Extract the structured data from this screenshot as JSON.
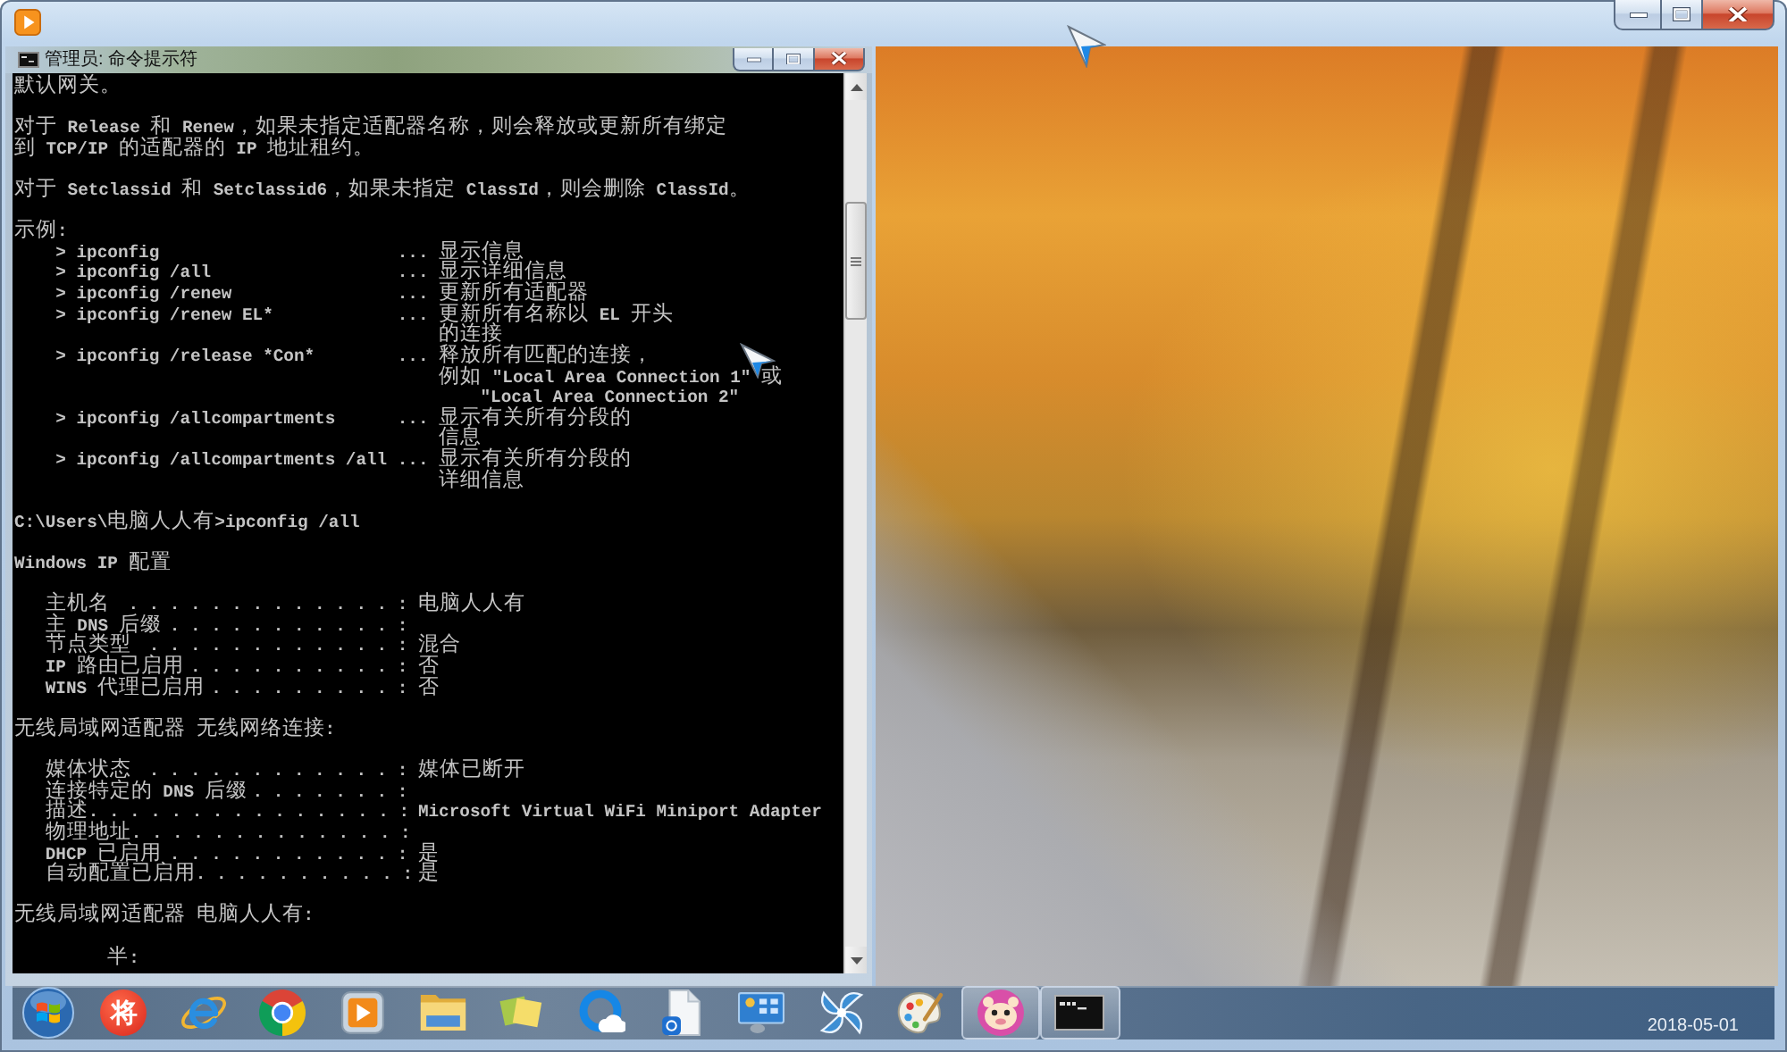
{
  "console_window": {
    "title": "管理员: 命令提示符",
    "sections": [
      {
        "kind": "text",
        "lines": [
          "默认网关。"
        ]
      },
      {
        "kind": "text",
        "lines": [
          "对于 Release 和 Renew，如果未指定适配器名称，则会释放或更新所有绑定",
          "到 TCP/IP 的适配器的 IP 地址租约。"
        ]
      },
      {
        "kind": "text",
        "lines": [
          "对于 Setclassid 和 Setclassid6，如果未指定 ClassId，则会删除 ClassId。"
        ]
      },
      {
        "kind": "examples",
        "heading": "示例:",
        "rows": [
          {
            "command": "> ipconfig",
            "leader": "...",
            "description": [
              "显示信息"
            ]
          },
          {
            "command": "> ipconfig /all",
            "leader": "...",
            "description": [
              "显示详细信息"
            ]
          },
          {
            "command": "> ipconfig /renew",
            "leader": "...",
            "description": [
              "更新所有适配器"
            ]
          },
          {
            "command": "> ipconfig /renew EL*",
            "leader": "...",
            "description": [
              "更新所有名称以 EL 开头",
              "的连接"
            ]
          },
          {
            "command": "> ipconfig /release *Con*",
            "leader": "...",
            "description": [
              "释放所有匹配的连接，",
              "例如 \"Local Area Connection 1\" 或",
              "    \"Local Area Connection 2\""
            ]
          },
          {
            "command": "> ipconfig /allcompartments",
            "leader": "...",
            "description": [
              "显示有关所有分段的",
              "信息"
            ]
          },
          {
            "command": "> ipconfig /allcompartments /all",
            "leader": "...",
            "description": [
              "显示有关所有分段的",
              "详细信息"
            ]
          }
        ]
      },
      {
        "kind": "text",
        "lines": [
          "C:\\Users\\电脑人人有>ipconfig /all"
        ]
      },
      {
        "kind": "text",
        "lines": [
          "Windows IP 配置"
        ]
      },
      {
        "kind": "config",
        "rows": [
          {
            "label": "主机名",
            "leader": ". . . . . . . . . . . . . :",
            "value": "电脑人人有"
          },
          {
            "label": "主 DNS 后缀",
            "leader": ". . . . . . . . . . . :"
          },
          {
            "label": "节点类型",
            "leader": ". . . . . . . . . . . . :",
            "value": "混合"
          },
          {
            "label": "IP 路由已启用",
            "leader": ". . . . . . . . . . :",
            "value": "否"
          },
          {
            "label": "WINS 代理已启用",
            "leader": ". . . . . . . . . :",
            "value": "否"
          }
        ]
      },
      {
        "kind": "text",
        "lines": [
          "无线局域网适配器 无线网络连接:"
        ]
      },
      {
        "kind": "config",
        "rows": [
          {
            "label": "媒体状态",
            "leader": ". . . . . . . . . . . . :",
            "value": "媒体已断开"
          },
          {
            "label": "连接特定的 DNS 后缀",
            "leader": ". . . . . . . :"
          },
          {
            "label": "描述",
            "leader": ". . . . . . . . . . . . . . . :",
            "value": "Microsoft Virtual WiFi Miniport Adapter"
          },
          {
            "label": "物理地址",
            "leader": ". . . . . . . . . . . . . :"
          },
          {
            "label": "DHCP 已启用",
            "leader": ". . . . . . . . . . . :",
            "value": "是"
          },
          {
            "label": "自动配置已启用",
            "leader": ". . . . . . . . . . :",
            "value": "是"
          }
        ]
      },
      {
        "kind": "text",
        "lines": [
          "无线局域网适配器 电脑人人有:"
        ]
      },
      {
        "kind": "text",
        "lines": [
          "         半:"
        ]
      }
    ]
  },
  "taskbar": {
    "items": [
      {
        "kind": "orb",
        "active": false
      },
      {
        "kind": "glyph",
        "label": "将",
        "active": false
      },
      {
        "kind": "e",
        "active": false
      },
      {
        "kind": "ring",
        "active": false
      },
      {
        "kind": "play",
        "active": false
      },
      {
        "kind": "folder",
        "active": false
      },
      {
        "kind": "notes",
        "active": false
      },
      {
        "kind": "bubble",
        "active": false
      },
      {
        "kind": "document",
        "active": false
      },
      {
        "kind": "panel",
        "active": false
      },
      {
        "kind": "pinwheel",
        "active": false
      },
      {
        "kind": "palette",
        "active": false
      },
      {
        "kind": "face",
        "active": true
      },
      {
        "kind": "terminal",
        "active": true
      }
    ],
    "date": "2018-05-01"
  }
}
